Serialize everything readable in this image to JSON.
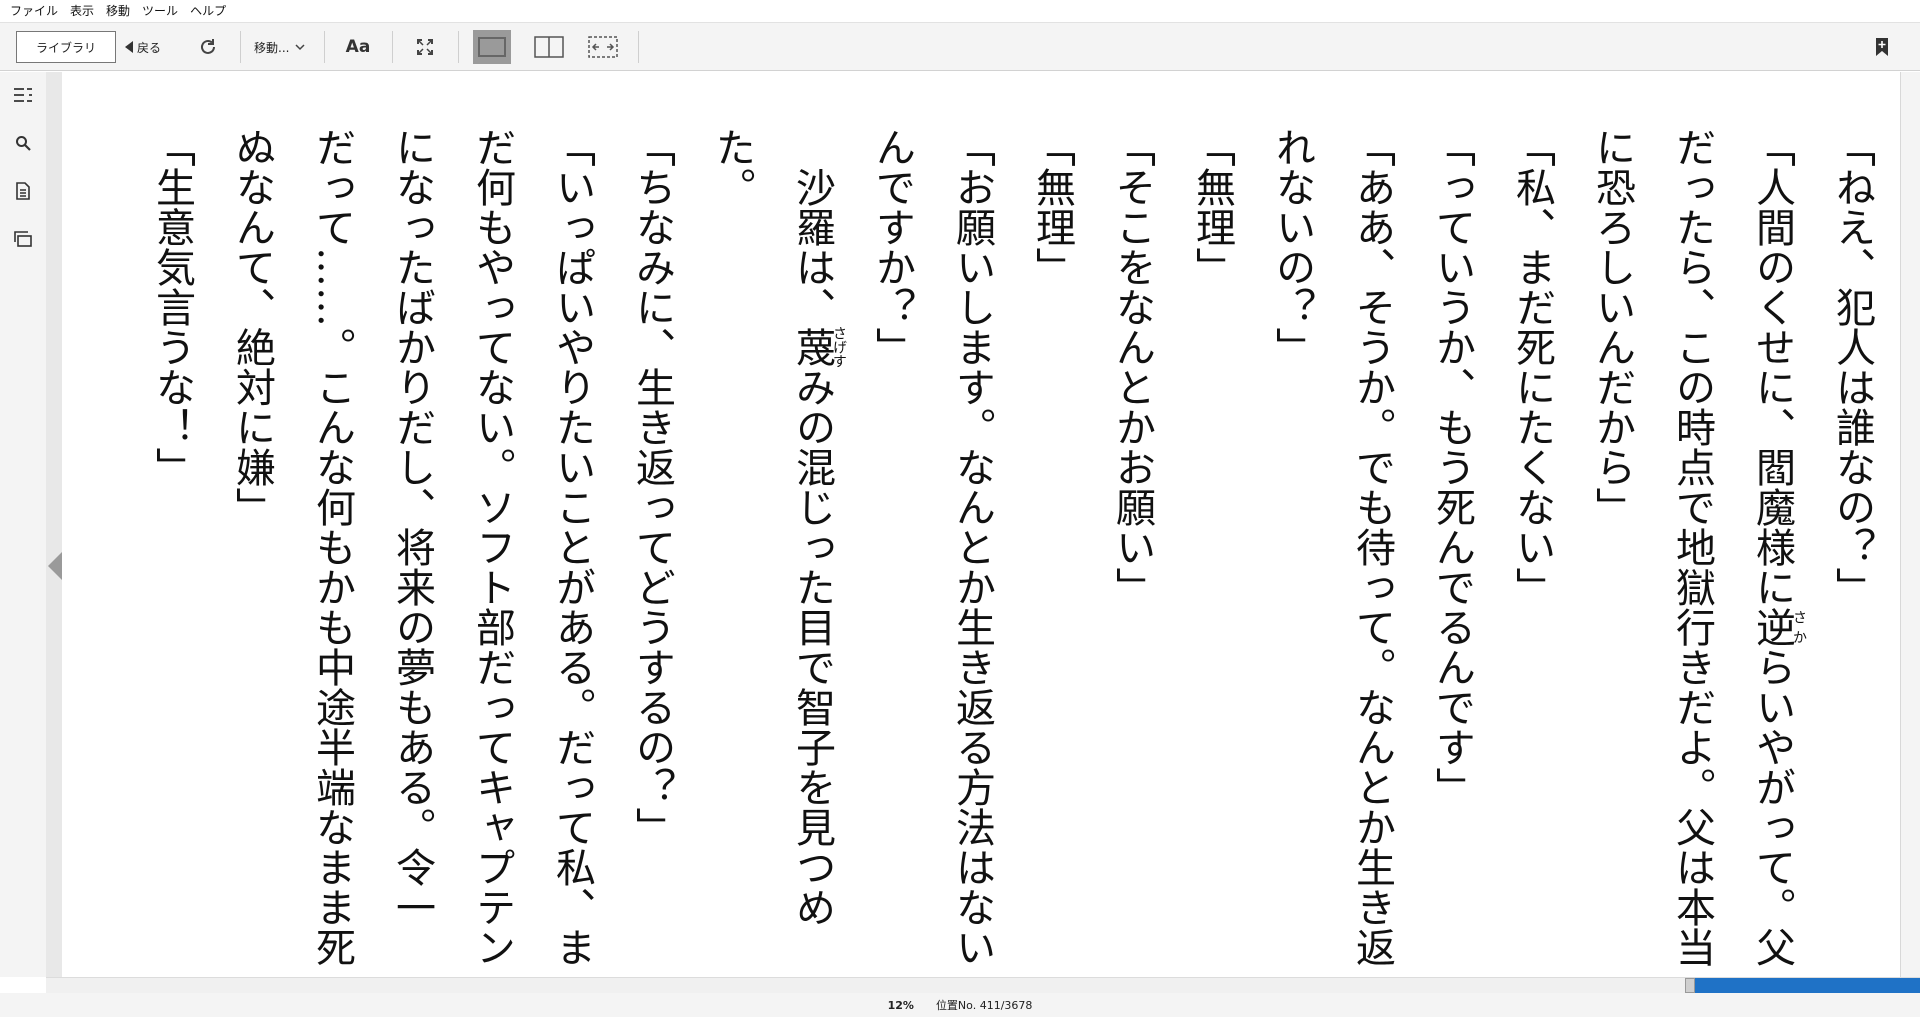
{
  "menu": [
    "ファイル",
    "表示",
    "移動",
    "ツール",
    "ヘルプ"
  ],
  "toolbar": {
    "library_label": "ライブラリ",
    "back_label": "戻る",
    "goto_label": "移動...",
    "font_label": "Aa",
    "sync_icon": "sync-icon",
    "fullscreen_icon": "fullscreen-icon",
    "single_page_icon": "single-page-view-icon",
    "two_page_icon": "two-page-view-icon",
    "continuous_icon": "continuous-view-icon",
    "bookmark_icon": "bookmark-add-icon"
  },
  "sidebar": [
    "table-of-contents-icon",
    "search-icon",
    "notes-icon",
    "flashcards-icon"
  ],
  "book": {
    "lines": [
      "「ねえ、犯人は誰なの？」",
      "「人間のくせに、閻魔様に逆らいやがって。父",
      "だったら、この時点で地獄行きだよ。父は本当",
      "に恐ろしいんだから」",
      "「私、まだ死にたくない」",
      "「っていうか、もう死んでるんです」",
      "「ああ、そうか。でも待って。なんとか生き返",
      "れないの？」",
      "「無理」",
      "「そこをなんとかお願い」",
      "「無理」",
      "「お願いします。なんとか生き返る方法はない",
      "んですか？」",
      "　沙羅は、蔑みの混じった目で智子を見つめ",
      "た。",
      "「ちなみに、生き返ってどうするの？」",
      "「いっぱいやりたいことがある。だって私、ま",
      "だ何もやってない。ソフト部だってキャプテン",
      "になったばかりだし、将来の夢もある。令一",
      "だって……。こんな何もかも中途半端なまま死",
      "ぬなんて、絶対に嫌」",
      "「生意気言うな！」"
    ],
    "ruby": [
      {
        "line": 1,
        "base": "逆",
        "reading": "さか"
      },
      {
        "line": 13,
        "base": "蔑",
        "reading": "さげす"
      }
    ]
  },
  "status": {
    "progress_percent": "12%",
    "location": "位置No. 411/3678",
    "progress_fraction": 0.12
  },
  "colors": {
    "accent": "#1f72c6"
  }
}
